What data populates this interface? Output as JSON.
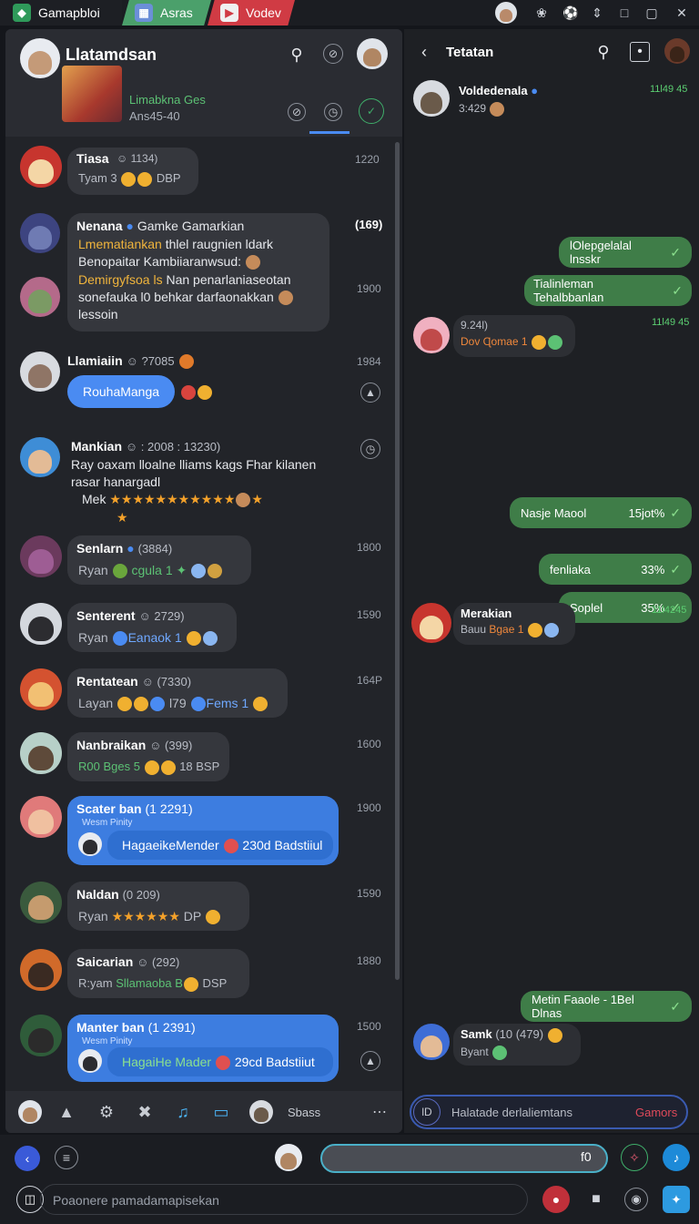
{
  "tabs": [
    {
      "label": "Gamapbloi",
      "color": "#2f9a5a"
    },
    {
      "label": "Asras",
      "color": "#4ba06b"
    },
    {
      "label": "Vodev",
      "color": "#d03b44"
    }
  ],
  "left": {
    "title": "Llatamdsan",
    "banner_line1": "Limabkna Ges",
    "banner_line2": "Ans45-40",
    "chats": [
      {
        "name": "Tiasa",
        "meta": "☺ 1134)",
        "line1": "Tyam 3",
        "line1b": "DBP",
        "time": "1220"
      },
      {
        "name": "Nenana",
        "meta": "Gamke Gamarkian",
        "l1": "Lmematiankan",
        "l1b": "thlel raugnien ldark",
        "l2": "Benopaitar Kambiiaranwsud:",
        "l3": "Demirgyfsoa ls",
        "l3b": "Nan penarlaniaseotan",
        "l4": "sonefauka l0 behkar darfaonakkan",
        "l5": "lessoin",
        "time": "(169)",
        "time2": "1900"
      },
      {
        "name": "Llamiaiin",
        "meta": "☺ ?7085",
        "pill": "RouhaManga",
        "time": "1984"
      },
      {
        "name": "Mankian",
        "meta": "☺ : 2008 : 13230)",
        "l1": "Ray oaxam lloalne lliams kags Fhar kilanen",
        "l2": "rasar hanargadl",
        "l3": "Mek"
      },
      {
        "name": "Senlarn",
        "meta": "(3884)",
        "sub": "Ryan",
        "tag": "cgula 1",
        "time": "1800"
      },
      {
        "name": "Senterent",
        "meta": "☺ 2729)",
        "sub": "Ryan",
        "tag": "Eanaok 1",
        "time": "1590"
      },
      {
        "name": "Rentatean",
        "meta": "☺ (7330)",
        "sub": "Layan",
        "tag": "l79",
        "tag2": "Fems 1",
        "time": "164P"
      },
      {
        "name": "Nanbraikan",
        "meta": "☺ (399)",
        "sub": "R00 Bges 5",
        "sub2": "18 BSP",
        "time": "1600"
      },
      {
        "name": "Scater ban",
        "meta": "(1 2291)",
        "small": "Wesm Pinity",
        "reply": "HagaeikeMender",
        "reply2": "230d Badstiiul",
        "time": "1900"
      },
      {
        "name": "Naldan",
        "meta": "(0 209)",
        "sub": "Ryan",
        "sub2": "DP",
        "time": "1590"
      },
      {
        "name": "Saicarian",
        "meta": "☺ (292)",
        "sub": "R:yam",
        "tag": "Sllamaoba B",
        "sub2": "DSP",
        "time": "1880"
      },
      {
        "name": "Manter ban",
        "meta": "(1 2391)",
        "small": "Wesm Pinity",
        "reply": "HagaiHe Mader",
        "reply2": "29cd Badstiiut",
        "time": "1500"
      }
    ],
    "bottom_label": "Sbass"
  },
  "right": {
    "title": "Tetatan",
    "contact_name": "Voldedenala",
    "contact_sub": "3:429",
    "contact_time": "11Ɩ49 45",
    "msgs": [
      {
        "text": "lOlepgelalal lnsskr"
      },
      {
        "text": "Tialinleman Tehalbbanlan"
      },
      {
        "time": "11Ɩ49 45",
        "meta": "9.24Ɩ)",
        "sub": "Dov Ɋomae 1"
      },
      {
        "text": "Nasje Maool",
        "pct": "15jot%"
      },
      {
        "text": "fenliaka",
        "pct": "33%"
      },
      {
        "text": "Soplel",
        "pct": "35%"
      },
      {
        "name": "Merakian",
        "time": "11Ɩ4245",
        "sub": "Bauu",
        "tag": "Bgae 1"
      },
      {
        "text": "Metin Faaole - 1Bel Dlnas"
      },
      {
        "name": "Samk",
        "meta": "(10 (479)",
        "sub": "Byant"
      }
    ],
    "input_tag": "lD",
    "input_placeholder": "Halatade derlaliemtans",
    "input_action": "Gamors"
  },
  "footer": {
    "field_value": "f0",
    "compose_placeholder": "Poaonere pamadamapisekan"
  }
}
